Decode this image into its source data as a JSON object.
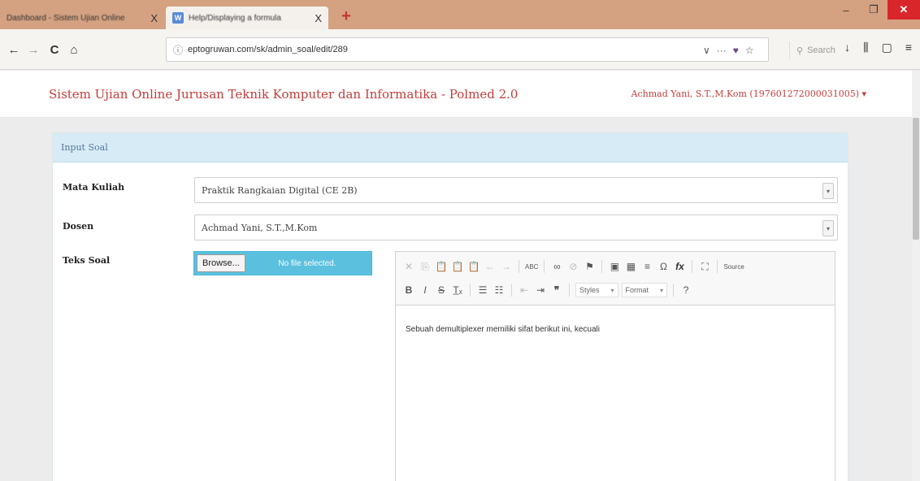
{
  "browser": {
    "tabs": [
      {
        "label": "Dashboard - Sistem Ujian Online",
        "close": "X"
      },
      {
        "label": "Help/Displaying a formula",
        "close": "X",
        "favicon": "W"
      }
    ],
    "new_tab": "+",
    "window": {
      "minimize": "–",
      "maximize": "❐",
      "close": "✕"
    },
    "nav": {
      "back": "←",
      "forward": "→",
      "reload": "C",
      "home": "⌂"
    },
    "url": "eptogruwan.com/sk/admin_soal/edit/289",
    "url_tools": {
      "dropdown": "∨",
      "more": "···",
      "pocket": "♥",
      "bookmark": "☆"
    },
    "search_placeholder": "Search",
    "right_tools": {
      "download": "↓",
      "library": "⫼",
      "sidebar": "▢",
      "menu": "≡"
    }
  },
  "app": {
    "title": "Sistem Ujian Online Jurusan Teknik Komputer dan Informatika - Polmed 2.0",
    "user": "Achmad Yani, S.T.,M.Kom (197601272000031005) ▾"
  },
  "panel": {
    "heading": "Input Soal",
    "fields": {
      "mata_kuliah": {
        "label": "Mata Kuliah",
        "value": "Praktik Rangkaian Digital (CE 2B)"
      },
      "dosen": {
        "label": "Dosen",
        "value": "Achmad Yani, S.T.,M.Kom"
      },
      "teks_soal": {
        "label": "Teks Soal"
      }
    },
    "file_input": {
      "button": "Browse...",
      "status": "No file selected."
    },
    "editor": {
      "toolbar1": [
        "✕",
        "⎘",
        "📋",
        "📋",
        "📋",
        "←",
        "→",
        "ABC",
        "∞",
        "⚑",
        "▣",
        "▦",
        "≡",
        "Ω",
        "fx",
        "⛶",
        "Source"
      ],
      "styles_label": "Styles",
      "format_label": "Format",
      "help": "?",
      "content": "Sebuah demultiplexer memiliki sifat berikut ini, kecuali"
    }
  }
}
